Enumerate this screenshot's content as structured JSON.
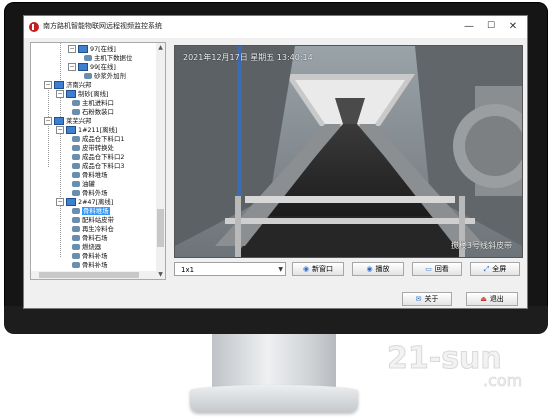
{
  "window": {
    "title": "南方路机智能物联网远程视频监控系统",
    "minimize": "—",
    "maximize": "☐",
    "close": "✕"
  },
  "tree": {
    "nodes": [
      {
        "label": "97[在线]",
        "type": "device",
        "expanded": true
      },
      {
        "label": "主机下数据位",
        "type": "camera"
      },
      {
        "label": "99[在线]",
        "type": "device",
        "expanded": true
      },
      {
        "label": "砂浆外加剂",
        "type": "camera"
      },
      {
        "label": "济南兴邦",
        "type": "group",
        "expanded": true
      },
      {
        "label": "制砂[离线]",
        "type": "device",
        "expanded": true
      },
      {
        "label": "主机进料口",
        "type": "camera"
      },
      {
        "label": "石粉数装口",
        "type": "camera"
      },
      {
        "label": "莱芜兴邦",
        "type": "group",
        "expanded": true
      },
      {
        "label": "1#211[离线]",
        "type": "device",
        "expanded": true
      },
      {
        "label": "成品仓下料口1",
        "type": "camera"
      },
      {
        "label": "皮带转换处",
        "type": "camera"
      },
      {
        "label": "成品仓下料口2",
        "type": "camera"
      },
      {
        "label": "成品仓下料口3",
        "type": "camera"
      },
      {
        "label": "骨料堆场",
        "type": "camera"
      },
      {
        "label": "油罐",
        "type": "camera"
      },
      {
        "label": "骨料外场",
        "type": "camera"
      },
      {
        "label": "2#47[离线]",
        "type": "device",
        "expanded": true
      },
      {
        "label": "骨料堆场",
        "type": "camera",
        "selected": true
      },
      {
        "label": "配料站皮带",
        "type": "camera"
      },
      {
        "label": "再生冷料仓",
        "type": "camera"
      },
      {
        "label": "骨料石场",
        "type": "camera"
      },
      {
        "label": "燃烧器",
        "type": "camera"
      },
      {
        "label": "骨料补场",
        "type": "camera"
      },
      {
        "label": "骨料补场",
        "type": "camera"
      },
      {
        "label": "油罐",
        "type": "camera"
      },
      {
        "label": "其他设备",
        "type": "camera"
      }
    ]
  },
  "video": {
    "osd_time": "2021年12月17日  星期五  13:40:14",
    "osd_camera": "搅楼3号线斜皮带"
  },
  "controls": {
    "layout_value": "1x1",
    "new_window": "新窗口",
    "playback": "播放",
    "review": "回看",
    "fullscreen": "全屏"
  },
  "bottom": {
    "about": "关于",
    "exit": "退出"
  },
  "watermark": "21-sun .com"
}
